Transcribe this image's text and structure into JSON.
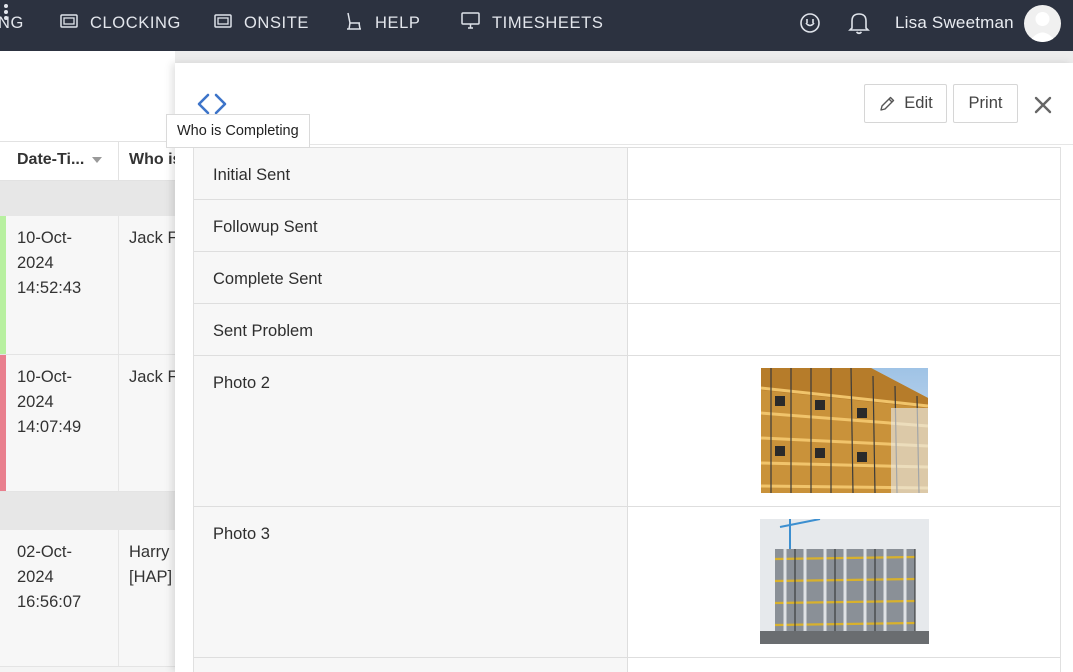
{
  "nav": {
    "cut_label": "NG",
    "items": [
      {
        "label": "CLOCKING",
        "icon": "id-card-icon"
      },
      {
        "label": "ONSITE",
        "icon": "id-card-icon"
      },
      {
        "label": "HELP",
        "icon": "chair-icon"
      },
      {
        "label": "TIMESHEETS",
        "icon": "monitor-icon"
      }
    ],
    "user_name": "Lisa Sweetman"
  },
  "list": {
    "columns": [
      "Date-Ti...",
      "Who is"
    ],
    "rows": [
      {
        "date": "10-Oct-2024 14:52:43",
        "who": "Jack F",
        "status_color": "#b8f0a0"
      },
      {
        "date": "10-Oct-2024 14:07:49",
        "who": "Jack F",
        "status_color": "#e97f8e"
      },
      {
        "date": "02-Oct-2024 16:56:07",
        "who": "Harry [HAP]",
        "status_color": "#f7f7f7"
      }
    ]
  },
  "panel": {
    "tooltip": "Who is Completing",
    "edit_label": "Edit",
    "print_label": "Print",
    "fields": [
      {
        "label": "Initial Sent",
        "value": ""
      },
      {
        "label": "Followup Sent",
        "value": ""
      },
      {
        "label": "Complete Sent",
        "value": ""
      },
      {
        "label": "Sent Problem",
        "value": ""
      },
      {
        "label": "Photo 2",
        "value": ""
      },
      {
        "label": "Photo 3",
        "value": ""
      }
    ]
  },
  "colors": {
    "nav_bg": "#2c3240",
    "accent_blue": "#3d74c9",
    "status_green": "#b8f0a0",
    "status_red": "#e97f8e"
  }
}
